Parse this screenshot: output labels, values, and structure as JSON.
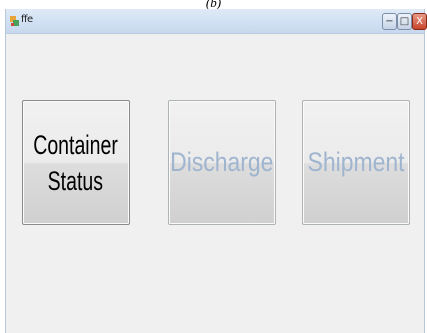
{
  "caption": "(b)",
  "window": {
    "title": "ffe",
    "controls": {
      "minimize": "−",
      "maximize": "□",
      "close": "X"
    }
  },
  "buttons": {
    "container_status_line1": "Container",
    "container_status_line2": "Status",
    "discharge": "Discharge",
    "shipment": "Shipment"
  }
}
